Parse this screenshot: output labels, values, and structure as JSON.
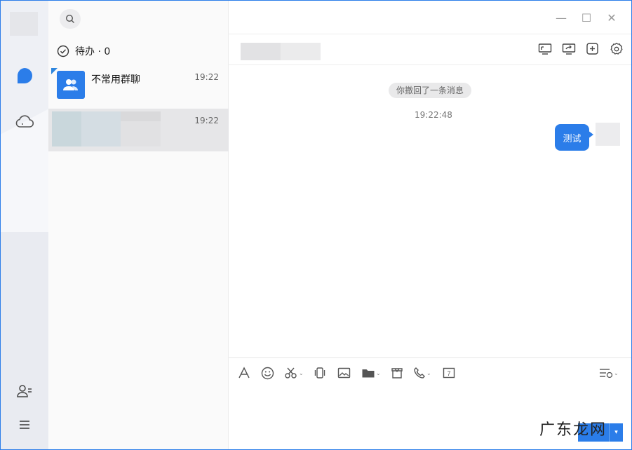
{
  "sidebar": {
    "items": [
      {
        "name": "messages",
        "icon": "chat-bubble-icon"
      },
      {
        "name": "cloud",
        "icon": "cloud-icon"
      },
      {
        "name": "contacts",
        "icon": "contacts-icon"
      },
      {
        "name": "menu",
        "icon": "menu-icon"
      }
    ],
    "accent_color": "#2b7de9"
  },
  "search": {
    "icon": "search-icon"
  },
  "todo": {
    "label": "待办 · 0"
  },
  "conversations": [
    {
      "name": "不常用群聊",
      "time": "19:22",
      "unread_marker": true
    },
    {
      "name": "",
      "time": "19:22",
      "active": true
    }
  ],
  "window_controls": {
    "minimize": "—",
    "maximize": "☐",
    "close": "✕"
  },
  "chat": {
    "recall_notice": "你撤回了一条消息",
    "timestamp": "19:22:48",
    "messages": [
      {
        "from": "me",
        "text": "测试"
      }
    ]
  },
  "header_icons": [
    "screen-share-icon",
    "remote-desktop-icon",
    "add-member-icon",
    "settings-icon"
  ],
  "toolbar": {
    "icons": [
      "font-icon",
      "emoji-icon",
      "screenshot-icon",
      "shake-icon",
      "image-icon",
      "folder-icon",
      "red-packet-icon",
      "phone-icon",
      "calendar-icon",
      "history-icon"
    ],
    "calendar_day": "7"
  },
  "send": {
    "dropdown": "▾"
  },
  "watermark": {
    "text": "广东龙网"
  }
}
